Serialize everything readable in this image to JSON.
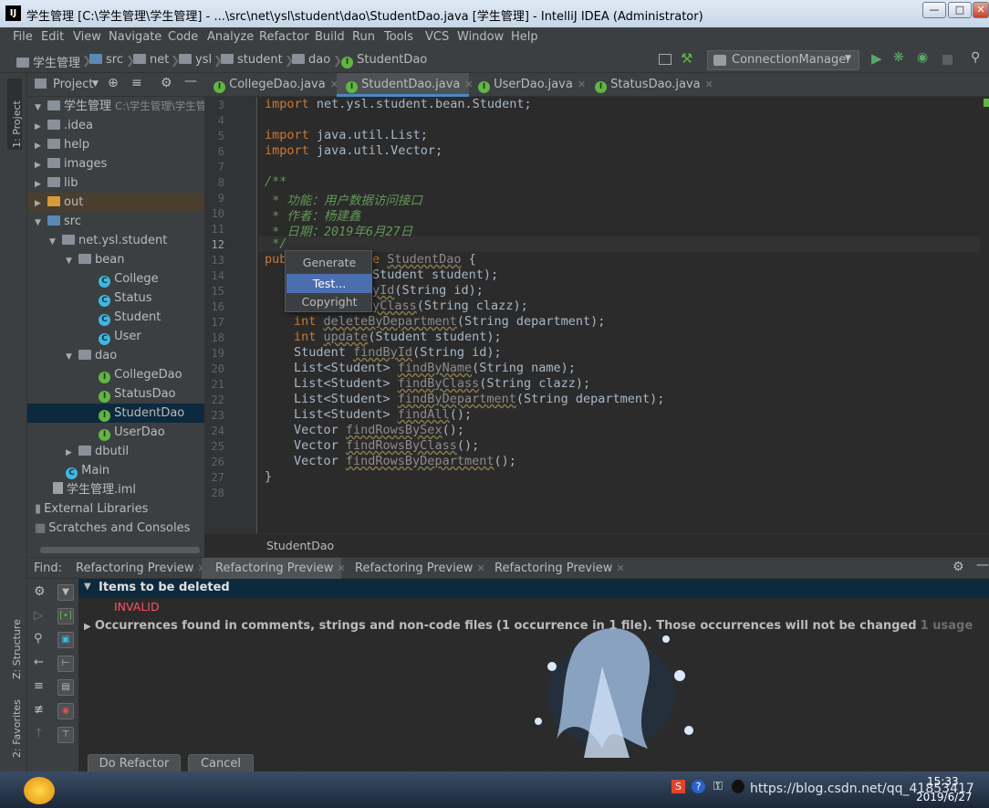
{
  "window": {
    "title": "学生管理 [C:\\学生管理\\学生管理] - ...\\src\\net\\ysl\\student\\dao\\StudentDao.java [学生管理] - IntelliJ IDEA (Administrator)",
    "app_icon": "IJ"
  },
  "menu": [
    "File",
    "Edit",
    "View",
    "Navigate",
    "Code",
    "Analyze",
    "Refactor",
    "Build",
    "Run",
    "Tools",
    "VCS",
    "Window",
    "Help"
  ],
  "breadcrumb": [
    "学生管理",
    "src",
    "net",
    "ysl",
    "student",
    "dao",
    "StudentDao"
  ],
  "run_config": "ConnectionManager",
  "side_tabs": {
    "project": "1: Project",
    "structure": "Z: Structure",
    "favorites": "2: Favorites"
  },
  "project_panel": {
    "title": "Project",
    "root": "学生管理",
    "root_path": "C:\\学生管理\\学生管理",
    "items": [
      {
        "label": ".idea"
      },
      {
        "label": "help"
      },
      {
        "label": "images"
      },
      {
        "label": "lib"
      },
      {
        "label": "out"
      },
      {
        "label": "src"
      },
      {
        "label": "net.ysl.student"
      },
      {
        "label": "bean"
      },
      {
        "label": "College"
      },
      {
        "label": "Status"
      },
      {
        "label": "Student"
      },
      {
        "label": "User"
      },
      {
        "label": "dao"
      },
      {
        "label": "CollegeDao"
      },
      {
        "label": "StatusDao"
      },
      {
        "label": "StudentDao"
      },
      {
        "label": "UserDao"
      },
      {
        "label": "dbutil"
      },
      {
        "label": "Main"
      },
      {
        "label": "学生管理.iml"
      },
      {
        "label": "External Libraries"
      },
      {
        "label": "Scratches and Consoles"
      }
    ]
  },
  "editor_tabs": [
    {
      "label": "CollegeDao.java"
    },
    {
      "label": "StudentDao.java"
    },
    {
      "label": "UserDao.java"
    },
    {
      "label": "StatusDao.java"
    }
  ],
  "code": {
    "line_numbers": [
      "3",
      "4",
      "5",
      "6",
      "7",
      "8",
      "9",
      "10",
      "11",
      "12",
      "13",
      "14",
      "15",
      "16",
      "17",
      "18",
      "19",
      "20",
      "21",
      "22",
      "23",
      "24",
      "25",
      "26",
      "27",
      "28"
    ],
    "import1_kw": "import",
    "import1": " net.ysl.student.bean.Student;",
    "import2_kw": "import",
    "import2": " java.util.List;",
    "import3_kw": "import",
    "import3": " java.util.Vector;",
    "doc_open": "/**",
    "doc1": " * 功能：用户数据访问接口",
    "doc2": " * 作者：杨建鑫",
    "doc3": " * 日期：2019年6月27日",
    "doc_close": " */",
    "l13_a": "pub",
    "l13_kw": "e ",
    "l13_name": "StudentDao",
    "l13_b": " {",
    "l14": "Student student);",
    "l15_a": "yId",
    "l15_b": "(String id);",
    "l16_a": "yClass",
    "l16_b": "(String clazz);",
    "l17_kw": "int",
    "l17_name": "deleteByDepartment",
    "l17_b": "(String department);",
    "l18_kw": "int",
    "l18_name": "update",
    "l18_b": "(Student student);",
    "l19_a": "Student ",
    "l19_name": "findById",
    "l19_b": "(String id);",
    "l20_a": "List<Student> ",
    "l20_name": "findByName",
    "l20_b": "(String name);",
    "l21_a": "List<Student> ",
    "l21_name": "findByClass",
    "l21_b": "(String clazz);",
    "l22_a": "List<Student> ",
    "l22_name": "findByDepartment",
    "l22_b": "(String department);",
    "l23_a": "List<Student> ",
    "l23_name": "findAll",
    "l23_b": "();",
    "l24_a": "Vector ",
    "l24_name": "findRowsBySex",
    "l24_b": "();",
    "l25_a": "Vector ",
    "l25_name": "findRowsByClass",
    "l25_b": "();",
    "l26_a": "Vector ",
    "l26_name": "findRowsByDepartment",
    "l26_b": "();",
    "l27": "}"
  },
  "editor_breadcrumb": "StudentDao",
  "generate_popup": [
    "Generate",
    "Test...",
    "Copyright"
  ],
  "find_panel": {
    "label": "Find:",
    "tabs": [
      "Refactoring Preview",
      "Refactoring Preview",
      "Refactoring Preview",
      "Refactoring Preview"
    ],
    "items_header": "Items to be deleted",
    "invalid": "INVALID",
    "occurrences": "Occurrences found in comments, strings and non-code files",
    "occurrences_detail": "(1 occurrence in 1 file). Those occurrences will not be changed",
    "usage": "1 usage",
    "do_refactor": "Do Refactor",
    "cancel": "Cancel"
  },
  "taskbar": {
    "time": "15:33",
    "date": "2019/6/27",
    "watermark": "https://blog.csdn.net/qq_41853417"
  }
}
